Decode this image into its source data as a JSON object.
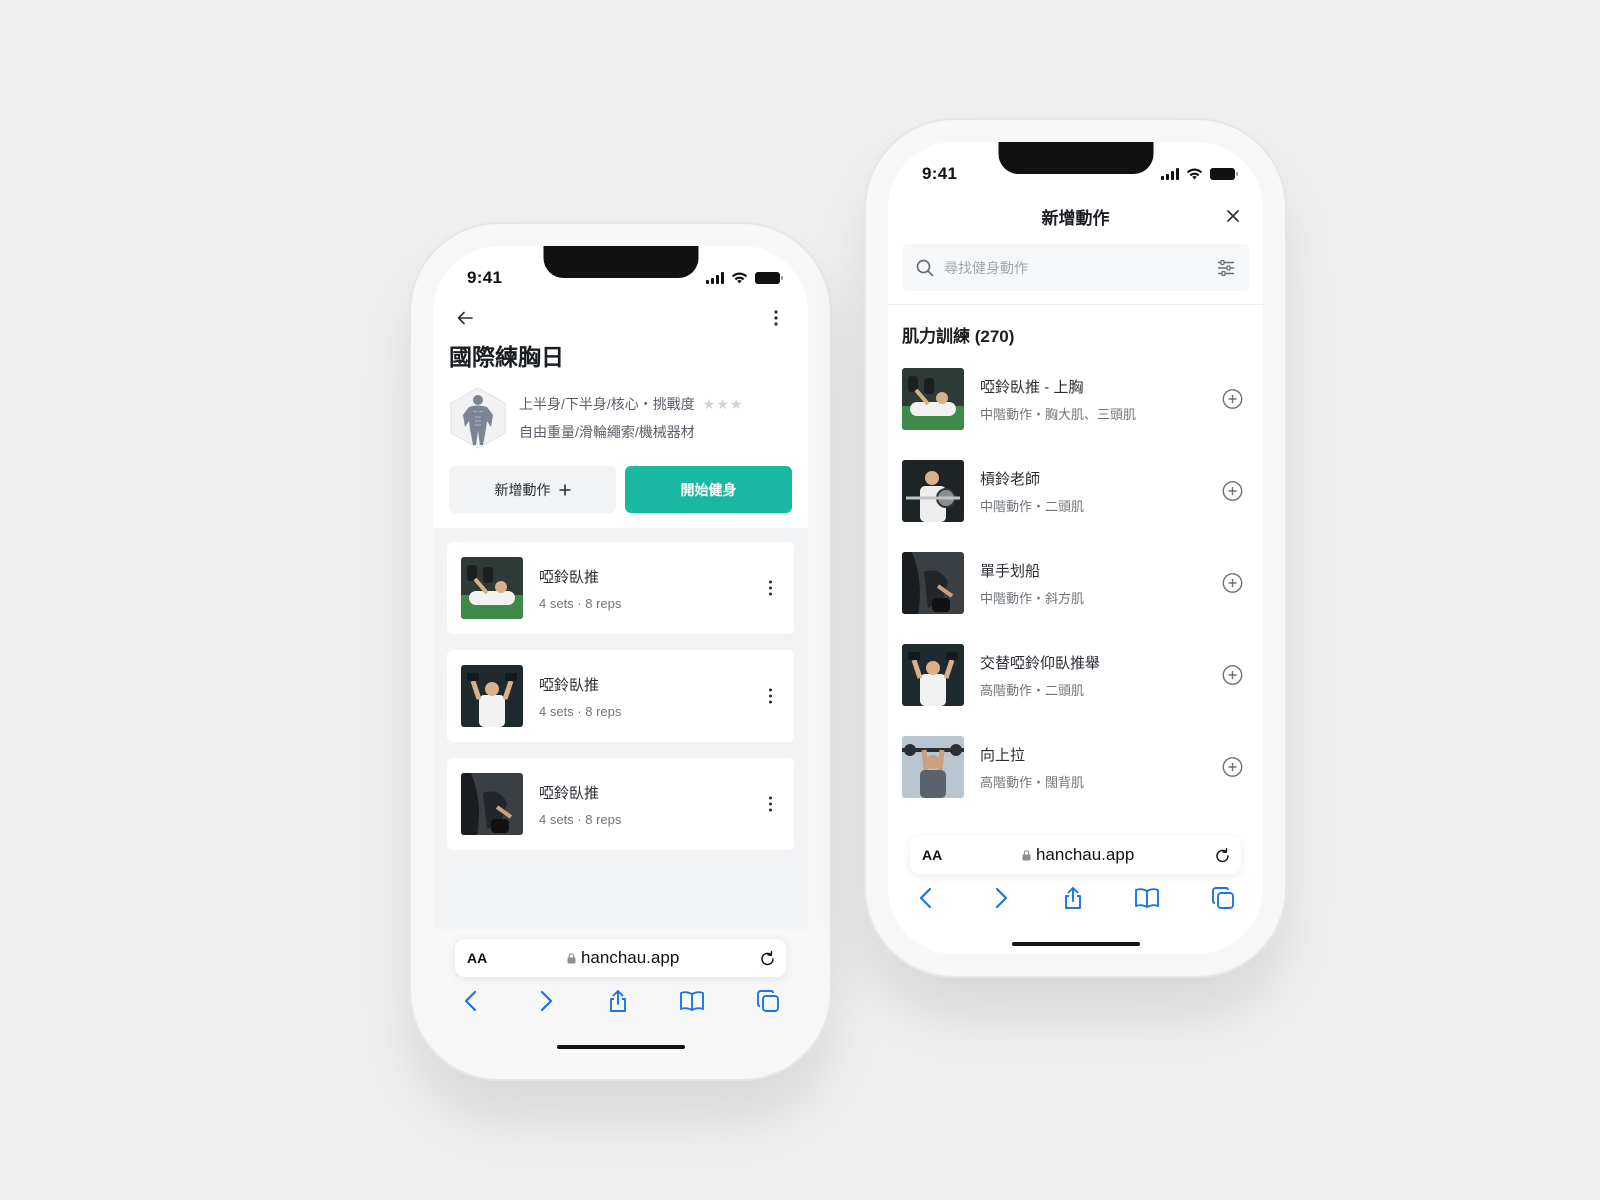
{
  "colors": {
    "accent": "#1ab8a2",
    "background": "#f0f0f1",
    "link_blue": "#1a73e8"
  },
  "left_screen": {
    "status_time": "9:41",
    "title": "國際練胸日",
    "plan": {
      "line1": "上半身/下半身/核心・挑戰度",
      "line2": "自由重量/滑輪繩索/機械器材",
      "difficulty_stars": 0
    },
    "buttons": {
      "add": "新增動作",
      "start": "開始健身"
    },
    "workouts": [
      {
        "name": "啞鈴臥推",
        "meta": "4 sets · 8 reps",
        "thumb": "bench"
      },
      {
        "name": "啞鈴臥推",
        "meta": "4 sets · 8 reps",
        "thumb": "curl"
      },
      {
        "name": "啞鈴臥推",
        "meta": "4 sets · 8 reps",
        "thumb": "row"
      }
    ],
    "safari": {
      "aa": "AA",
      "url": "hanchau.app"
    }
  },
  "right_screen": {
    "status_time": "9:41",
    "title": "新增動作",
    "search": {
      "placeholder": "尋找健身動作",
      "value": ""
    },
    "section_title": "肌力訓練 (270)",
    "exercises": [
      {
        "name": "啞鈴臥推 - 上胸",
        "meta": "中階動作・胸大肌、三頭肌",
        "thumb": "bench"
      },
      {
        "name": "槓鈴老師",
        "meta": "中階動作・二頭肌",
        "thumb": "barbell"
      },
      {
        "name": "單手划船",
        "meta": "中階動作・斜方肌",
        "thumb": "row"
      },
      {
        "name": "交替啞鈴仰臥推舉",
        "meta": "高階動作・二頭肌",
        "thumb": "curl"
      },
      {
        "name": "向上拉",
        "meta": "高階動作・闊背肌",
        "thumb": "pullup"
      }
    ],
    "safari": {
      "aa": "AA",
      "url": "hanchau.app"
    }
  }
}
